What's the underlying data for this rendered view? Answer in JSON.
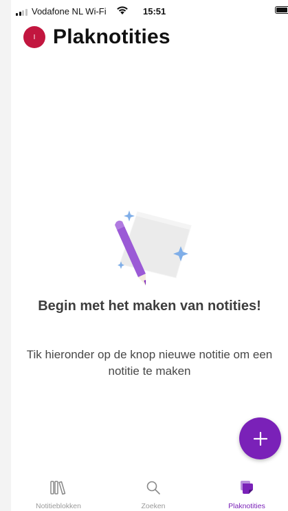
{
  "status_bar": {
    "carrier": "Vodafone NL Wi-Fi",
    "time": "15:51"
  },
  "header": {
    "avatar_initial": "I",
    "title": "Plaknotities"
  },
  "empty_state": {
    "title": "Begin met het maken van notities!",
    "description": "Tik hieronder op de knop nieuwe notitie om een notitie te maken"
  },
  "fab": {
    "icon": "plus-icon"
  },
  "tabs": [
    {
      "label": "Notitieblokken",
      "icon": "notebooks-icon",
      "active": false
    },
    {
      "label": "Zoeken",
      "icon": "search-icon",
      "active": false
    },
    {
      "label": "Plaknotities",
      "icon": "sticky-notes-icon",
      "active": true
    }
  ],
  "colors": {
    "accent": "#7a21b8",
    "avatar": "#c2163f",
    "inactive_tab": "#9a9a9a"
  }
}
